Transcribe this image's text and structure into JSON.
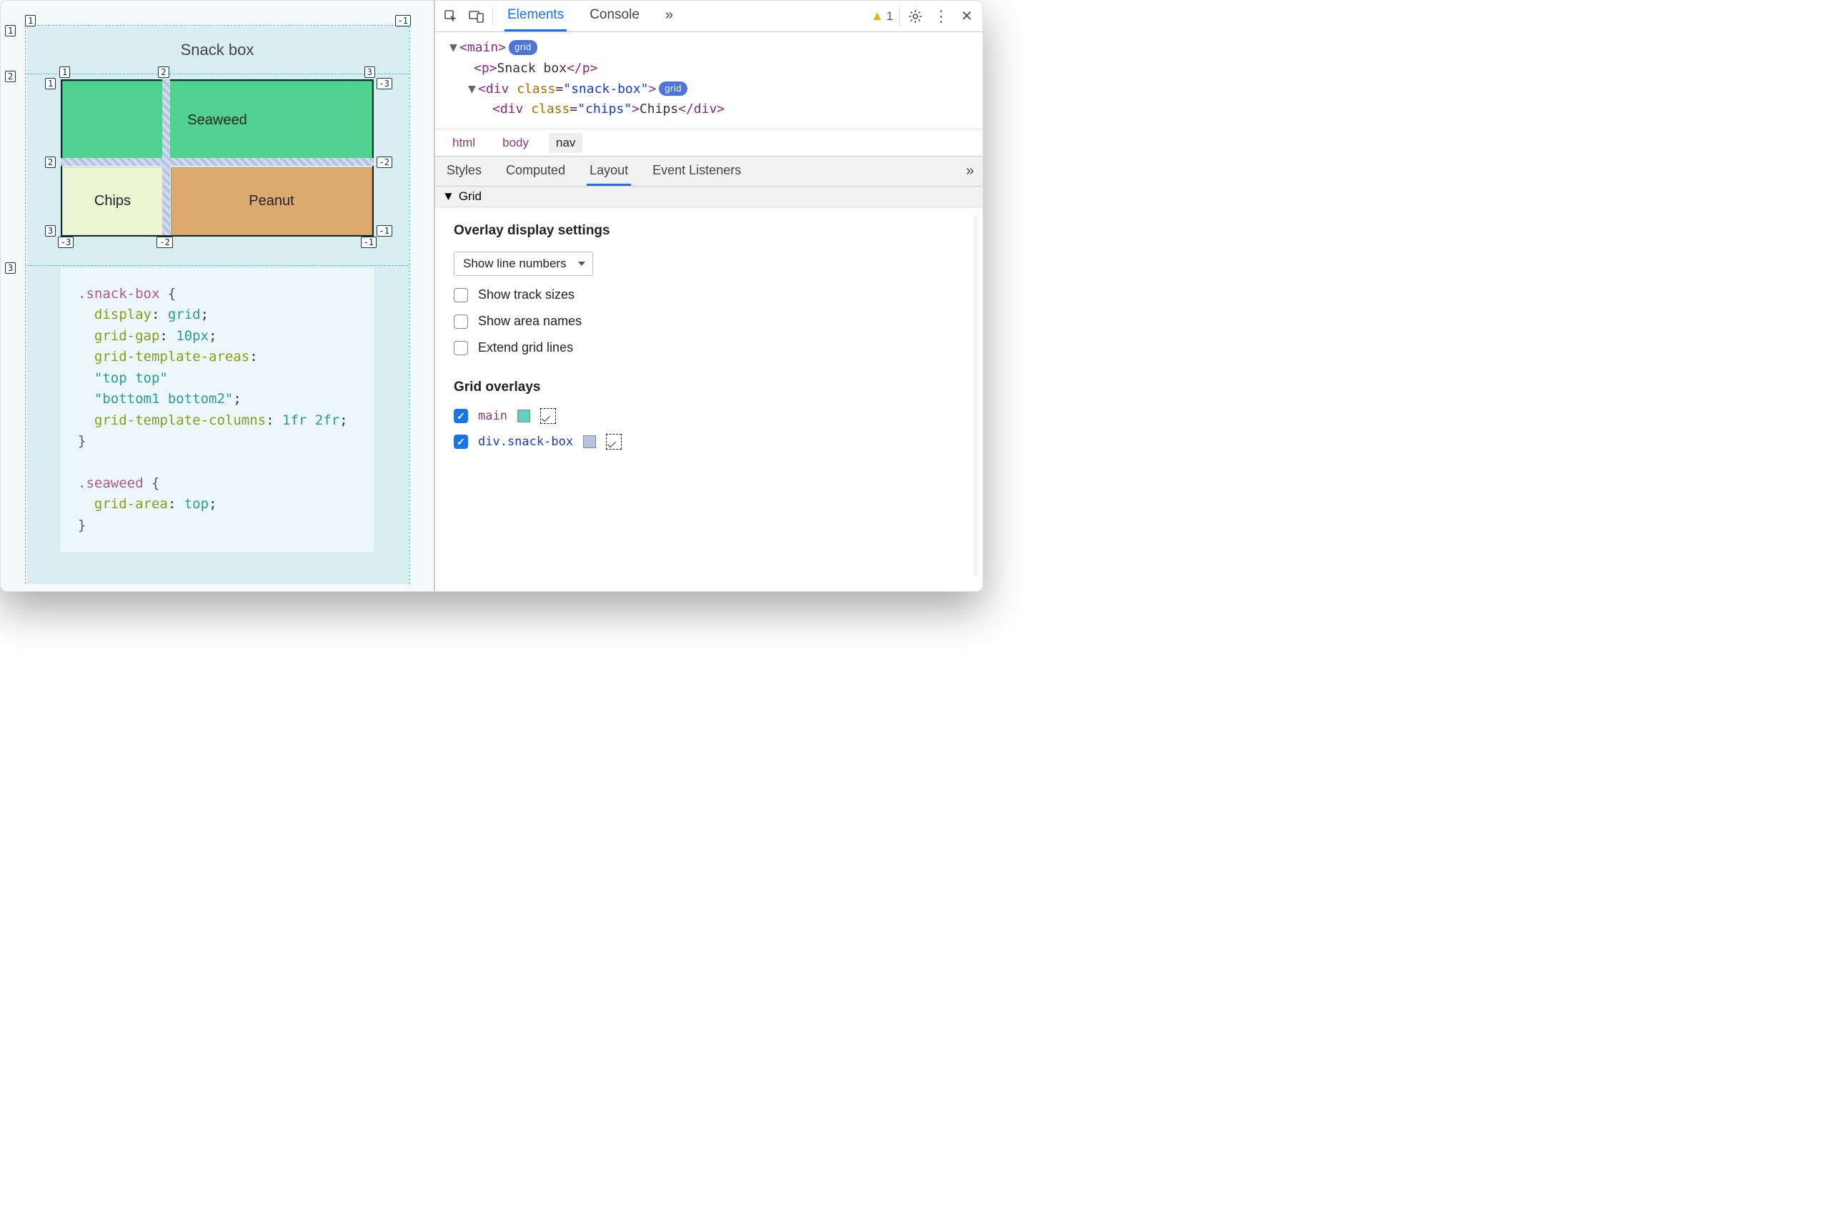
{
  "page": {
    "title": "Snack box",
    "grid_cells": {
      "seaweed": "Seaweed",
      "chips": "Chips",
      "peanut": "Peanut"
    },
    "line_numbers": {
      "outer_top": [
        "1",
        "-1"
      ],
      "outer_row": [
        "1",
        "2",
        "3"
      ],
      "inner_col_top": [
        "1",
        "2",
        "3"
      ],
      "inner_col_neg": [
        "-3",
        "-2",
        "-1"
      ],
      "inner_row_left": [
        "1",
        "2",
        "3"
      ],
      "inner_row_right_neg": [
        "-3",
        "-2",
        "-1"
      ]
    },
    "code": ".snack-box {\n  display: grid;\n  grid-gap: 10px;\n  grid-template-areas:\n  \"top top\"\n  \"bottom1 bottom2\";\n  grid-template-columns: 1fr 2fr;\n}\n\n.seaweed {\n  grid-area: top;\n}"
  },
  "devtools": {
    "tabs": {
      "elements": "Elements",
      "console": "Console"
    },
    "warn_count": "1",
    "dom": {
      "l1": "<main>",
      "l1_pill": "grid",
      "l2": "<p>Snack box</p>",
      "l3a": "<div class=\"",
      "l3b": "snack-box",
      "l3c": "\">",
      "l3_pill": "grid",
      "l4": "<div class=\"chips\">Chips</div>"
    },
    "breadcrumb": [
      "html",
      "body",
      "nav"
    ],
    "subtabs": {
      "styles": "Styles",
      "computed": "Computed",
      "layout": "Layout",
      "listeners": "Event Listeners"
    },
    "grid_panel": {
      "header": "Grid",
      "overlay_title": "Overlay display settings",
      "select_value": "Show line numbers",
      "opts": {
        "track": "Show track sizes",
        "areas": "Show area names",
        "extend": "Extend grid lines"
      },
      "overlays_title": "Grid overlays",
      "overlays": [
        {
          "name": "main",
          "cls": "main",
          "color": "#5fd1be",
          "checked": true
        },
        {
          "name": "div.snack-box",
          "cls": "snack",
          "color": "#b6c3e0",
          "checked": true
        }
      ]
    }
  }
}
